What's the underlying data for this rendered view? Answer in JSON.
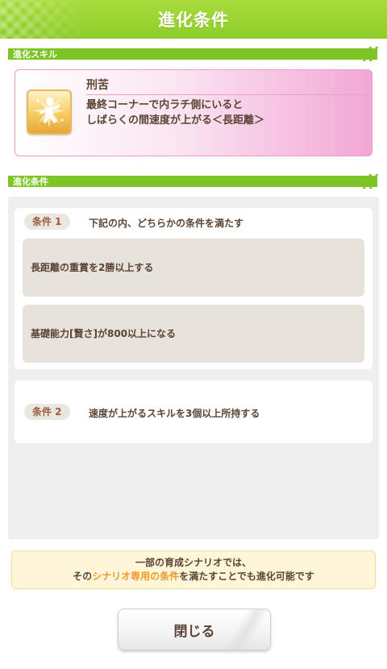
{
  "dialog": {
    "title": "進化条件"
  },
  "skill_section": {
    "label": "進化スキル",
    "skill": {
      "icon": "speed-up-runner-icon",
      "name": "刑苦",
      "description": "最終コーナーで内ラチ側にいると\nしばらくの間速度が上がる＜長距離＞"
    }
  },
  "conditions_section": {
    "label": "進化条件",
    "conditions": [
      {
        "tag": "条件 1",
        "text": "下記の内、どちらかの条件を満たす",
        "items": [
          "長距離の重賞を2勝以上する",
          "基礎能力[賢さ]が800以上になる"
        ]
      },
      {
        "tag": "条件 2",
        "text": "速度が上がるスキルを3個以上所持する"
      }
    ]
  },
  "notice": {
    "line1": "一部の育成シナリオでは、",
    "line2_prefix": "その",
    "line2_highlight": "シナリオ専用の条件",
    "line2_suffix": "を満たすことでも進化可能です"
  },
  "close_button": {
    "label": "閉じる"
  },
  "colors": {
    "accent": "#8dcc2a",
    "highlight": "#f09a28",
    "text": "#5a4434"
  }
}
